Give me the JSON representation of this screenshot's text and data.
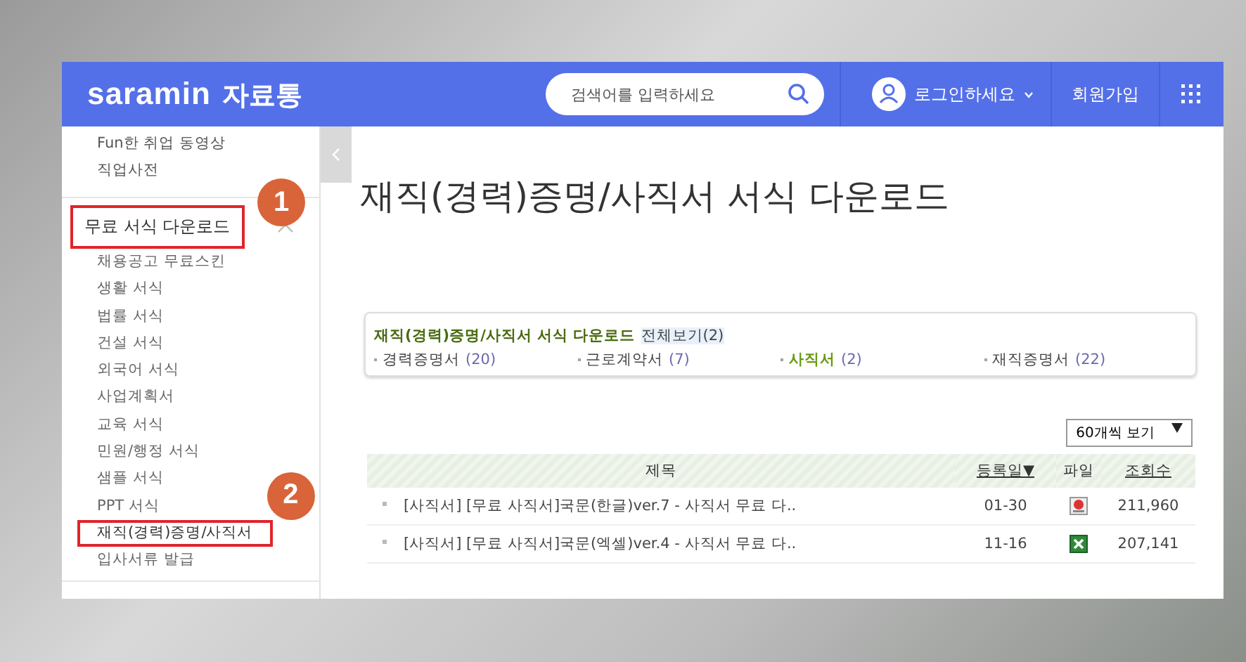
{
  "header": {
    "logo": "saramin",
    "logo_sub": "자료통",
    "search": {
      "placeholder": "검색어를 입력하세요"
    },
    "login": "로그인하세요",
    "signup": "회원가입"
  },
  "sidebar": {
    "top_items": [
      "Fun한 취업 동영상",
      "직업사전"
    ],
    "section": {
      "title": "무료 서식 다운로드",
      "expanded": true,
      "highlighted": true,
      "annotation": "1",
      "items": [
        {
          "label": "채용공고 무료스킨",
          "selected": false,
          "highlighted": false
        },
        {
          "label": "생활 서식",
          "selected": false,
          "highlighted": false
        },
        {
          "label": "법률 서식",
          "selected": false,
          "highlighted": false
        },
        {
          "label": "건설 서식",
          "selected": false,
          "highlighted": false
        },
        {
          "label": "외국어 서식",
          "selected": false,
          "highlighted": false
        },
        {
          "label": "사업계획서",
          "selected": false,
          "highlighted": false
        },
        {
          "label": "교육 서식",
          "selected": false,
          "highlighted": false
        },
        {
          "label": "민원/행정 서식",
          "selected": false,
          "highlighted": false
        },
        {
          "label": "샘플 서식",
          "selected": false,
          "highlighted": false
        },
        {
          "label": "PPT 서식",
          "selected": false,
          "highlighted": false
        },
        {
          "label": "재직(경력)증명/사직서",
          "selected": true,
          "highlighted": true,
          "annotation": "2"
        },
        {
          "label": "입사서류 발급",
          "selected": false,
          "highlighted": false
        }
      ]
    }
  },
  "page_title": "재직(경력)증명/사직서 서식 다운로드",
  "category_box": {
    "title": "재직(경력)증명/사직서 서식 다운로드",
    "all_link": "전체보기(2)",
    "categories": [
      {
        "label": "경력증명서",
        "count": "(20)",
        "selected": false
      },
      {
        "label": "근로계약서",
        "count": "(7)",
        "selected": false
      },
      {
        "label": "사직서",
        "count": "(2)",
        "selected": true
      },
      {
        "label": "재직증명서",
        "count": "(22)",
        "selected": false
      }
    ]
  },
  "page_size": "60개씩 보기",
  "table": {
    "columns": [
      {
        "label": "제목",
        "sortable": false
      },
      {
        "label": "등록일▼",
        "sortable": true
      },
      {
        "label": "파일",
        "sortable": false
      },
      {
        "label": "조회수",
        "sortable": true
      }
    ],
    "rows": [
      {
        "title": "[사직서] [무료 사직서]국문(한글)ver.7 - 사직서 무료 다..",
        "date": "01-30",
        "kind": "hwp",
        "views": "211,960"
      },
      {
        "title": "[사직서] [무료 사직서]국문(엑셀)ver.4 - 사직서 무료 다..",
        "date": "11-16",
        "kind": "excel",
        "views": "207,141"
      }
    ]
  }
}
